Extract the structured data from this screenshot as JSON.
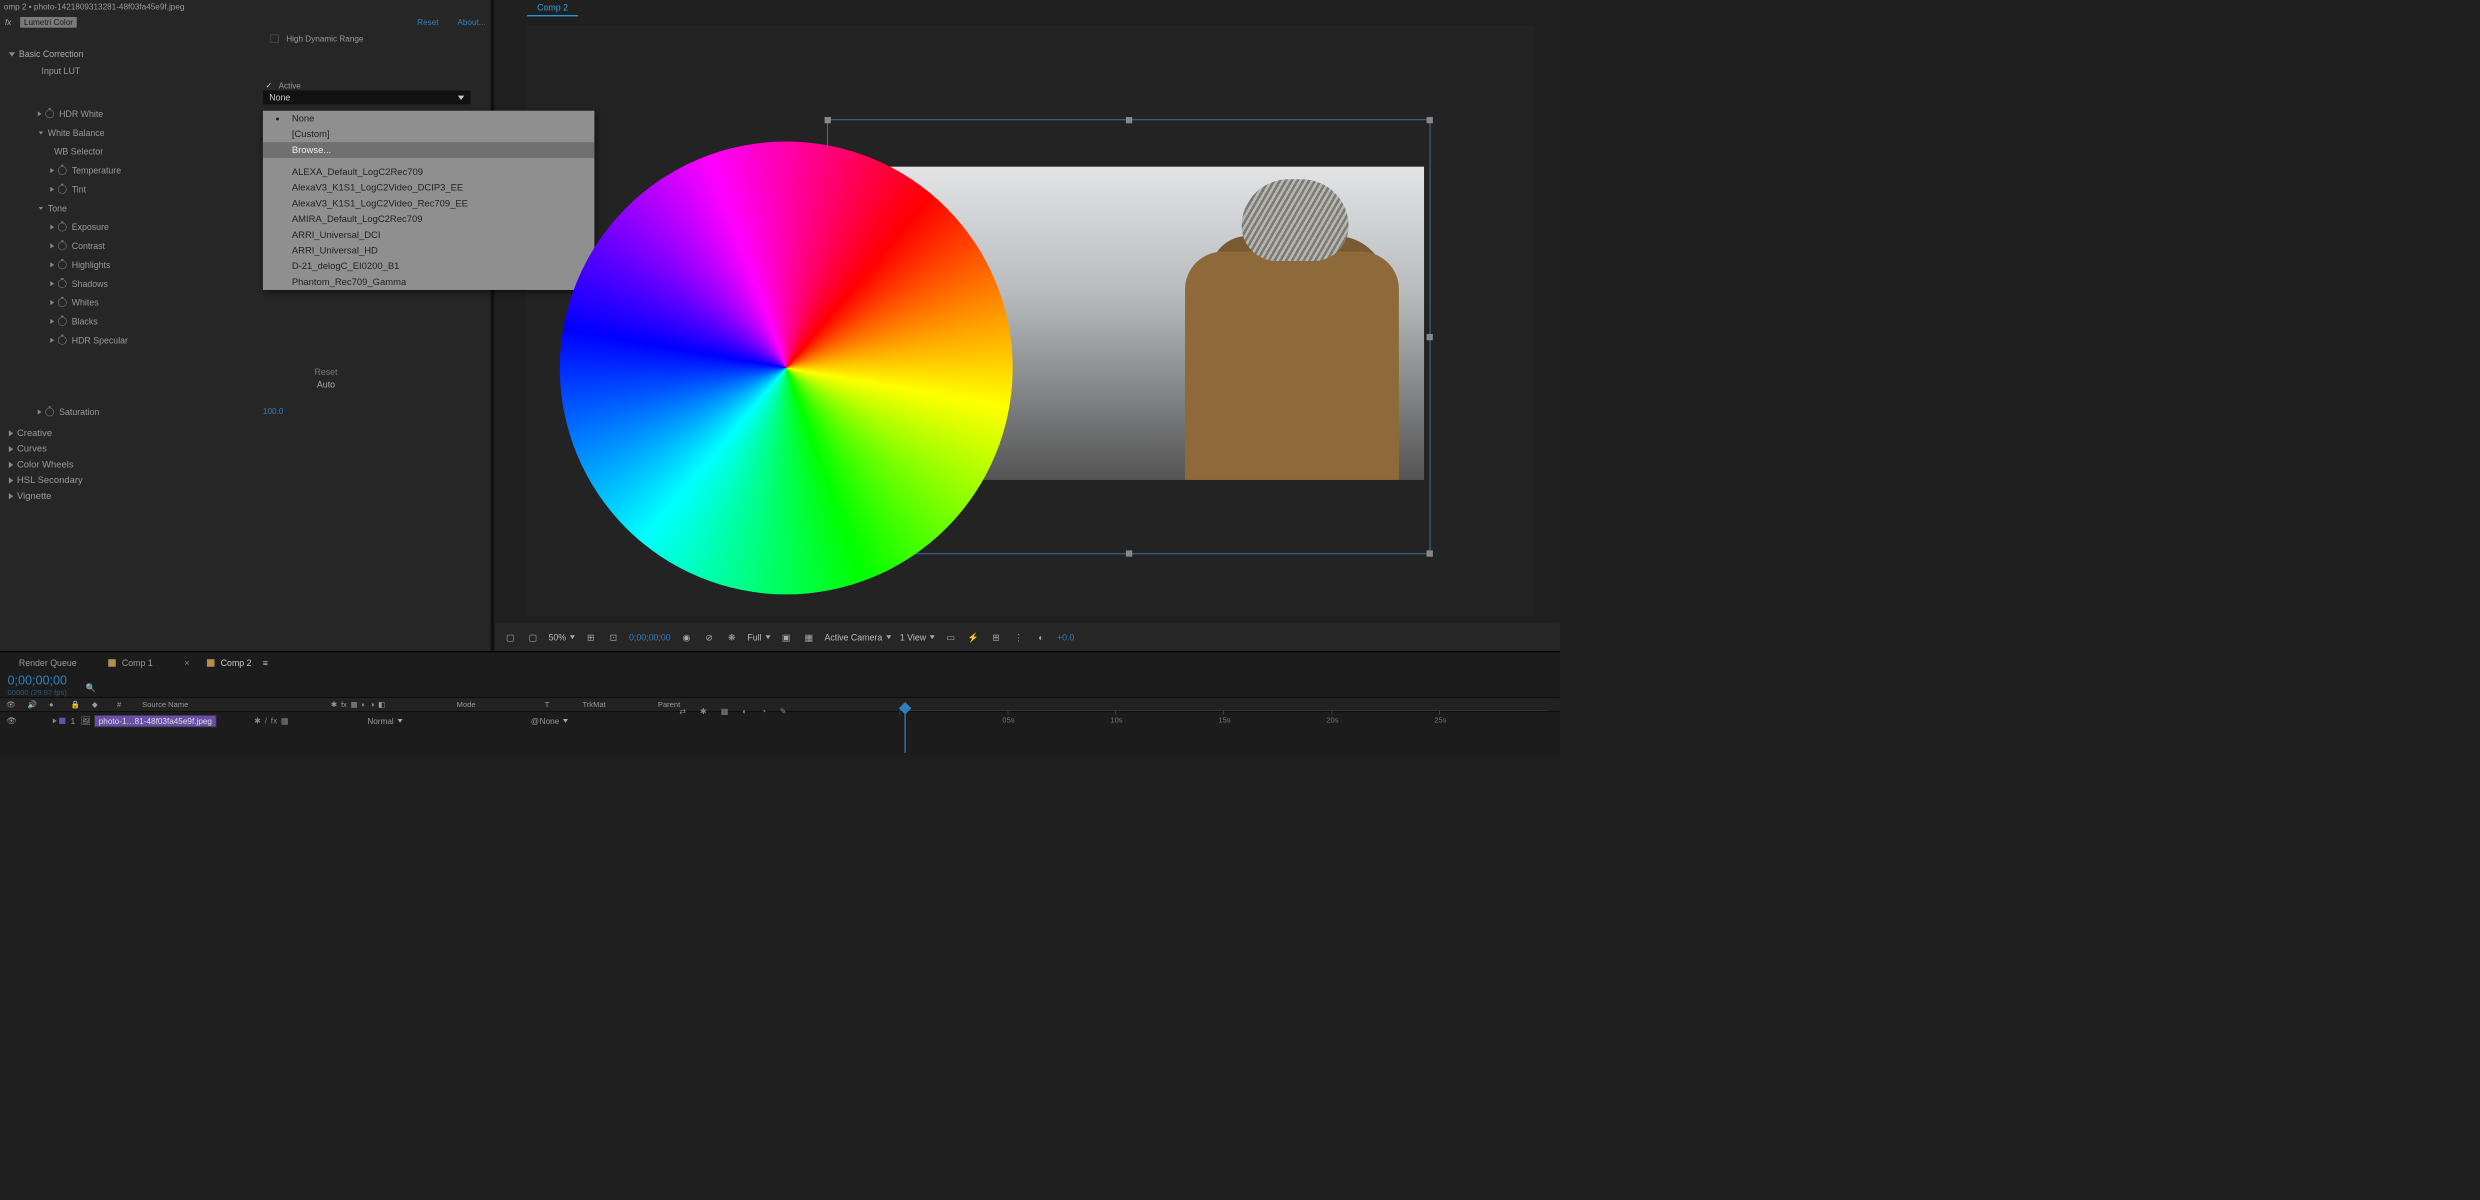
{
  "doc_title": "omp 2 • photo-1421809313281-48f03fa45e9f.jpeg",
  "fx_prefix": "fx",
  "effect_name": "Lumetri Color",
  "links": {
    "reset": "Reset",
    "about": "About..."
  },
  "hdr_label": "High Dynamic Range",
  "sections": {
    "basic": "Basic Correction",
    "creative": "Creative",
    "curves": "Curves",
    "wheels": "Color Wheels",
    "hsl": "HSL Secondary",
    "vignette": "Vignette"
  },
  "props": {
    "input_lut": "Input LUT",
    "hdr_white": "HDR White",
    "white_balance": "White Balance",
    "wb_selector": "WB Selector",
    "temperature": "Temperature",
    "tint": "Tint",
    "tone": "Tone",
    "exposure": "Exposure",
    "contrast": "Contrast",
    "highlights": "Highlights",
    "shadows": "Shadows",
    "whites": "Whites",
    "blacks": "Blacks",
    "hdr_specular": "HDR Specular",
    "saturation": "Saturation"
  },
  "active_label": "Active",
  "dropdown_value": "None",
  "lut_menu": {
    "none": "None",
    "custom": "[Custom]",
    "browse": "Browse...",
    "items": [
      "ALEXA_Default_LogC2Rec709",
      "AlexaV3_K1S1_LogC2Video_DCIP3_EE",
      "AlexaV3_K1S1_LogC2Video_Rec709_EE",
      "AMIRA_Default_LogC2Rec709",
      "ARRI_Universal_DCI",
      "ARRI_Universal_HD",
      "D-21_delogC_EI0200_B1",
      "Phantom_Rec709_Gamma"
    ]
  },
  "reset_btn": "Reset",
  "auto_btn": "Auto",
  "saturation_val": "100.0",
  "viewer_tab": "Comp 2",
  "viewer_footer": {
    "zoom": "50%",
    "timecode": "0;00;00;00",
    "resolution": "Full",
    "camera": "Active Camera",
    "views": "1 View",
    "exposure": "+0.0"
  },
  "bottom": {
    "tab_render": "Render Queue",
    "tab_comp1": "Comp 1",
    "tab_comp2": "Comp 2",
    "timecode": "0;00;00;00",
    "fps": "00000 (29.97 fps)",
    "cols": {
      "num": "#",
      "source": "Source Name",
      "mode": "Mode",
      "t": "T",
      "trkmat": "TrkMat",
      "parent": "Parent"
    },
    "layer_num": "1",
    "layer_name": "photo-1…81-48f03fa45e9f.jpeg",
    "mode_val": "Normal",
    "parent_val": "None",
    "ticks": [
      "05s",
      "10s",
      "15s",
      "20s",
      "25s"
    ]
  }
}
